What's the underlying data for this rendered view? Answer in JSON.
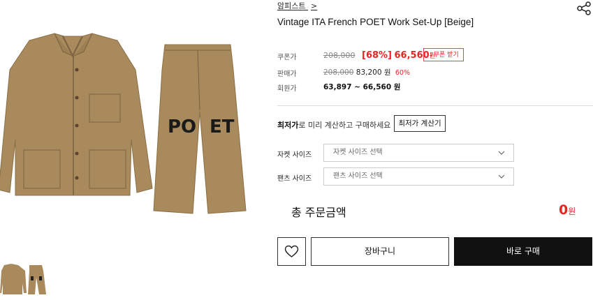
{
  "brand": {
    "name": "암피스트",
    "chevron": ">"
  },
  "product": {
    "title": "Vintage ITA French POET Work Set-Up [Beige]"
  },
  "pricing": {
    "coupon_label": "쿠폰가",
    "coupon_original": "208,000",
    "coupon_discount": "[68%]",
    "coupon_price": "66,560",
    "coupon_unit": "원",
    "coupon_button": "↓쿠폰 받기",
    "sale_label": "판매가",
    "sale_original": "208,000",
    "sale_price": "83,200 원",
    "sale_discount": "60%",
    "member_label": "회원가",
    "member_price": "63,897 ~ 66,560 원"
  },
  "calc": {
    "bold": "최저가",
    "text": "로 미리 계산하고 구매하세요",
    "button": "최저가 계산기"
  },
  "options": {
    "jacket_label": "자켓 사이즈",
    "jacket_placeholder": "자켓 사이즈 선택",
    "pants_label": "팬츠 사이즈",
    "pants_placeholder": "팬츠 사이즈 선택"
  },
  "total": {
    "label": "총 주문금액",
    "amount": "0",
    "unit": "원"
  },
  "actions": {
    "cart": "장바구니",
    "buy": "바로 구매"
  },
  "image": {
    "print_p": "PO",
    "print_e": "ET"
  },
  "colors": {
    "accent": "#e22222",
    "garment": "#a88a5c",
    "buy_bg": "#111111"
  }
}
